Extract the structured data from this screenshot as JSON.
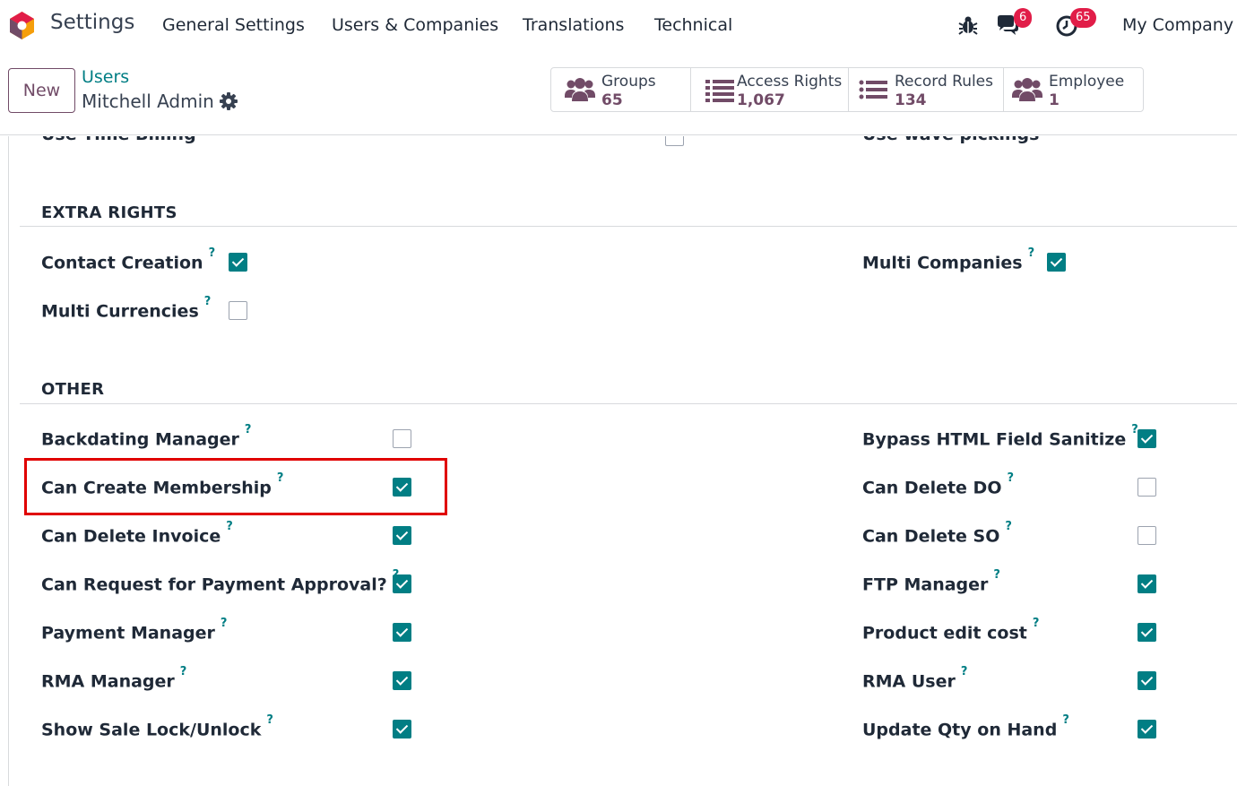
{
  "navbar": {
    "app_title": "Settings",
    "menus": [
      "General Settings",
      "Users & Companies",
      "Translations",
      "Technical"
    ],
    "icons": {
      "debug": "bug-icon",
      "messages": "chat-icon",
      "activities": "clock-icon"
    },
    "messages_badge": "6",
    "activities_badge": "65",
    "company": "My Company"
  },
  "control_panel": {
    "new_button": "New",
    "breadcrumb": "Users",
    "record_name": "Mitchell Admin",
    "stats": [
      {
        "label": "Groups",
        "value": "65",
        "icon": "users-icon"
      },
      {
        "label": "Access Rights",
        "value": "1,067",
        "icon": "list-icon"
      },
      {
        "label": "Record Rules",
        "value": "134",
        "icon": "list-icon"
      },
      {
        "label": "Employee",
        "value": "1",
        "icon": "users-icon"
      }
    ]
  },
  "form": {
    "top_cut": {
      "left_label": "Use Time Billing",
      "left_checked": false,
      "right_label": "Use wave pickings"
    },
    "extra_rights": {
      "title": "EXTRA RIGHTS",
      "left": [
        {
          "label": "Contact Creation",
          "checked": true
        },
        {
          "label": "Multi Currencies",
          "checked": false
        }
      ],
      "right": [
        {
          "label": "Multi Companies",
          "checked": true
        }
      ]
    },
    "other": {
      "title": "OTHER",
      "left": [
        {
          "label": "Backdating Manager",
          "checked": false
        },
        {
          "label": "Can Create Membership",
          "checked": true,
          "highlighted": true
        },
        {
          "label": "Can Delete Invoice",
          "checked": true
        },
        {
          "label": "Can Request for Payment Approval?",
          "checked": true
        },
        {
          "label": "Payment Manager",
          "checked": true
        },
        {
          "label": "RMA Manager",
          "checked": true
        },
        {
          "label": "Show Sale Lock/Unlock",
          "checked": true
        }
      ],
      "right": [
        {
          "label": "Bypass HTML Field Sanitize",
          "checked": true
        },
        {
          "label": "Can Delete DO",
          "checked": false
        },
        {
          "label": "Can Delete SO",
          "checked": false
        },
        {
          "label": "FTP Manager",
          "checked": true
        },
        {
          "label": "Product edit cost",
          "checked": true
        },
        {
          "label": "RMA User",
          "checked": true
        },
        {
          "label": "Update Qty on Hand",
          "checked": true
        }
      ]
    },
    "help_mark": "?"
  },
  "colors": {
    "accent": "#017e84",
    "brand": "#714b67",
    "badge": "#e11d48",
    "highlight": "#e00000"
  }
}
